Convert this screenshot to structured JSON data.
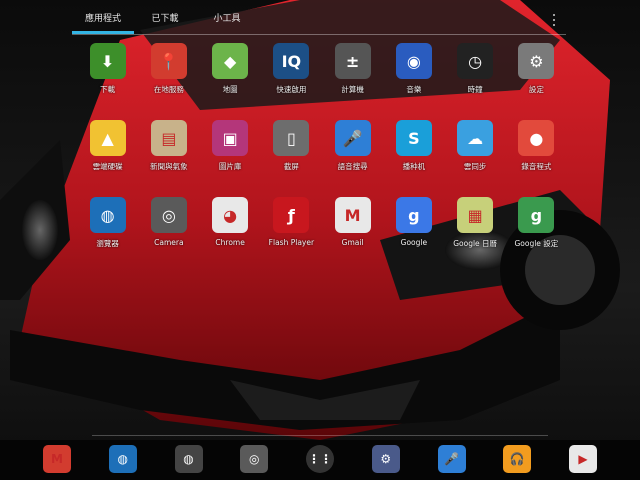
{
  "tabs": [
    {
      "label": "應用程式",
      "active": true
    },
    {
      "label": "已下載",
      "active": false
    },
    {
      "label": "小工具",
      "active": false
    }
  ],
  "apps": [
    {
      "label": "下載",
      "icon": "download-icon",
      "color": "#3d8f2a"
    },
    {
      "label": "在地服務",
      "icon": "local-pin-icon",
      "color": "#d23c2f"
    },
    {
      "label": "地圖",
      "icon": "maps-icon",
      "color": "#6cb44a"
    },
    {
      "label": "快速啟用",
      "icon": "quick-launch-icon",
      "color": "#1c4f86"
    },
    {
      "label": "計算機",
      "icon": "calculator-icon",
      "color": "#555555"
    },
    {
      "label": "音樂",
      "icon": "music-icon",
      "color": "#2a5cbf"
    },
    {
      "label": "時鐘",
      "icon": "clock-icon",
      "color": "#222222"
    },
    {
      "label": "設定",
      "icon": "settings-icon",
      "color": "#7a7a7a"
    },
    {
      "label": "雲端硬碟",
      "icon": "drive-icon",
      "color": "#f1c232"
    },
    {
      "label": "新聞與氣象",
      "icon": "news-weather-icon",
      "color": "#c8b28a"
    },
    {
      "label": "圖片庫",
      "icon": "gallery-icon",
      "color": "#b4367a"
    },
    {
      "label": "截屏",
      "icon": "screenshot-icon",
      "color": "#6d6d6d"
    },
    {
      "label": "語音搜尋",
      "icon": "voice-search-icon",
      "color": "#2e7fd6"
    },
    {
      "label": "播种机",
      "icon": "skype-icon",
      "color": "#1a9fd9"
    },
    {
      "label": "雲同步",
      "icon": "cloud-sync-icon",
      "color": "#3aa0e0"
    },
    {
      "label": "錄音程式",
      "icon": "recorder-icon",
      "color": "#e24a3c"
    },
    {
      "label": "瀏覽器",
      "icon": "browser-icon",
      "color": "#1d6fb8"
    },
    {
      "label": "Camera",
      "icon": "camera-icon",
      "color": "#5a5a5a"
    },
    {
      "label": "Chrome",
      "icon": "chrome-icon",
      "color": "#e8e8e8"
    },
    {
      "label": "Flash Player",
      "icon": "flash-icon",
      "color": "#c8171e"
    },
    {
      "label": "Gmail",
      "icon": "gmail-icon",
      "color": "#e8e8e8"
    },
    {
      "label": "Google",
      "icon": "google-search-icon",
      "color": "#3b78e7"
    },
    {
      "label": "Google 日曆",
      "icon": "calendar-icon",
      "color": "#c7d07a"
    },
    {
      "label": "Google 設定",
      "icon": "google-settings-icon",
      "color": "#3a9a4e"
    }
  ],
  "dock": [
    {
      "icon": "gmail-icon",
      "color": "#d23c2f"
    },
    {
      "icon": "browser-icon",
      "color": "#1d6fb8"
    },
    {
      "icon": "globe-icon",
      "color": "#444444"
    },
    {
      "icon": "camera-icon",
      "color": "#5a5a5a"
    },
    {
      "icon": "all-apps-icon",
      "color": "#333333"
    },
    {
      "icon": "settings-icon",
      "color": "#4a5a8a"
    },
    {
      "icon": "voice-search-icon",
      "color": "#2e7fd6"
    },
    {
      "icon": "play-music-icon",
      "color": "#f29c1f"
    },
    {
      "icon": "play-store-icon",
      "color": "#e8e8e8"
    }
  ]
}
